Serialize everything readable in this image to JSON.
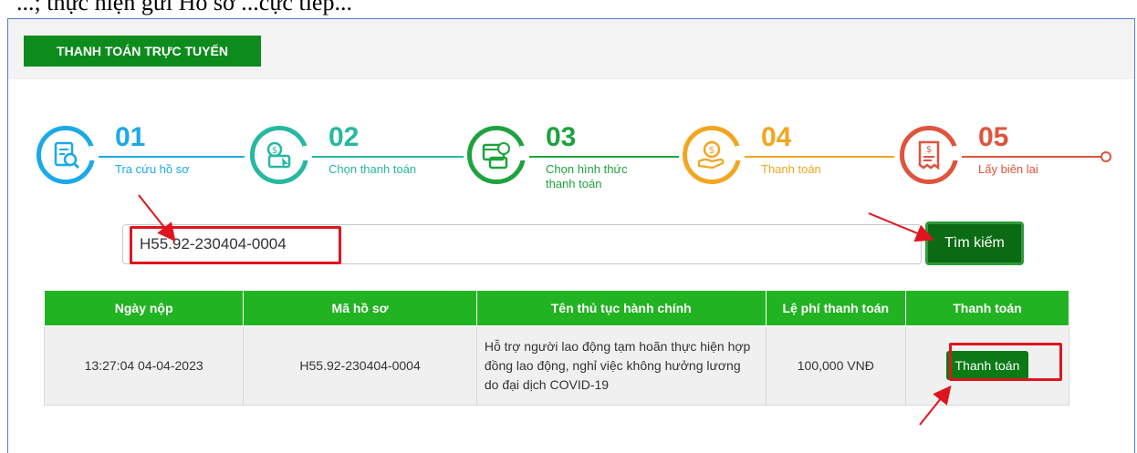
{
  "doc_line": "...; thực hiện gửi Hồ sơ ...cực tiếp...",
  "panel_title": "THANH TOÁN TRỰC TUYẾN",
  "steps": [
    {
      "num": "01",
      "label": "Tra cứu hồ sơ",
      "color": "#1ba9e8",
      "icon": "document-search-icon"
    },
    {
      "num": "02",
      "label": "Chọn thanh toán",
      "color": "#26b8a0",
      "icon": "payment-click-icon"
    },
    {
      "num": "03",
      "label": "Chọn hình thức",
      "label2": "thanh toán",
      "color": "#1ea23e",
      "icon": "payment-method-icon"
    },
    {
      "num": "04",
      "label": "Thanh toán",
      "color": "#f2a620",
      "icon": "hand-money-icon"
    },
    {
      "num": "05",
      "label": "Lấy biên lai",
      "color": "#e0533c",
      "icon": "receipt-icon"
    }
  ],
  "search": {
    "value": "H55.92-230404-0004",
    "button_label": "Tìm kiếm"
  },
  "table": {
    "headers": [
      "Ngày nộp",
      "Mã hồ sơ",
      "Tên thủ tục hành chính",
      "Lệ phí thanh toán",
      "Thanh toán"
    ],
    "rows": [
      {
        "date": "13:27:04 04-04-2023",
        "code": "H55.92-230404-0004",
        "procedure": "Hỗ trợ người lao động tạm hoãn thực hiện hợp đồng lao động, nghỉ việc không hưởng lương do đại dịch COVID-19",
        "fee": "100,000 VNĐ",
        "pay_label": "Thanh toán"
      }
    ]
  },
  "colors": {
    "brand_green": "#0d8c1d",
    "table_header": "#22b322",
    "highlight": "#e0141e"
  }
}
